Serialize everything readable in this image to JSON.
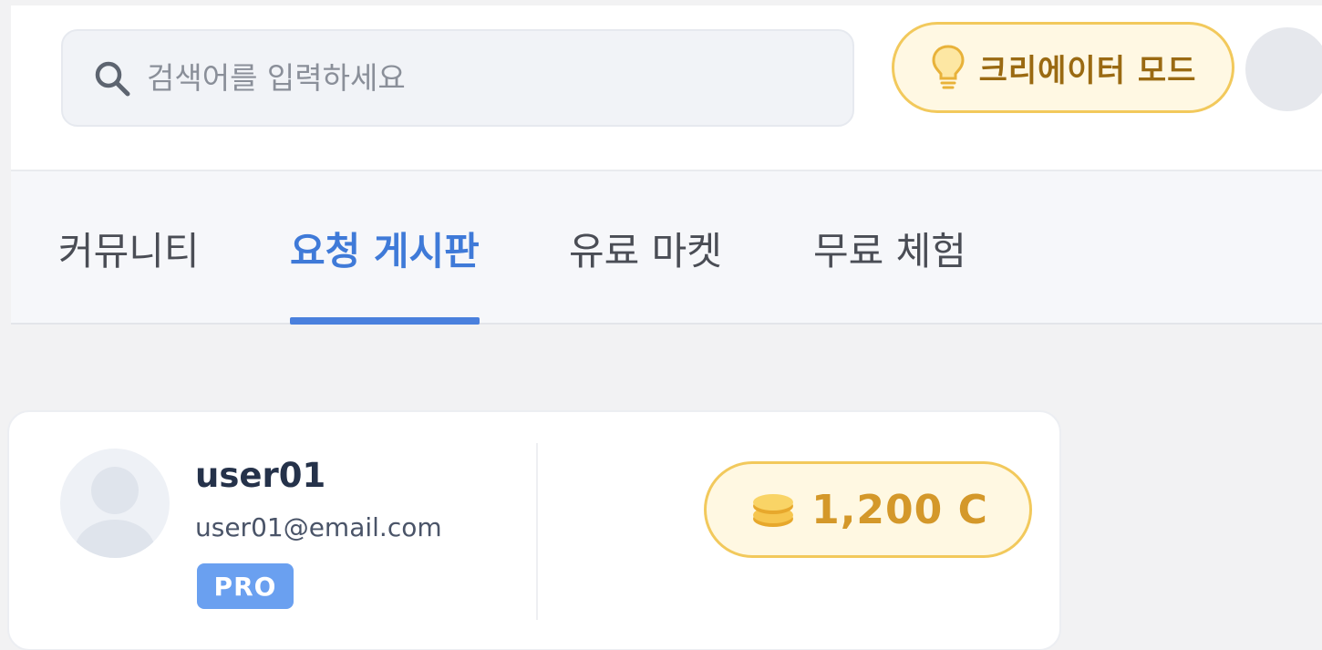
{
  "header": {
    "search": {
      "placeholder": "검색어를 입력하세요",
      "value": ""
    },
    "creator_mode_label": "크리에이터 모드"
  },
  "tabs": [
    {
      "label": "커뮤니티",
      "active": false
    },
    {
      "label": "요청 게시판",
      "active": true
    },
    {
      "label": "유료 마켓",
      "active": false
    },
    {
      "label": "무료 체험",
      "active": false
    }
  ],
  "profile": {
    "username": "user01",
    "email": "user01@email.com",
    "badge": "PRO",
    "credits": "1,200 C"
  },
  "colors": {
    "accent_blue": "#4a80dd",
    "gold": "#d4982a",
    "gold_border": "#f2c95c",
    "badge_blue": "#6aa0f0"
  },
  "icons": [
    "search-icon",
    "lightbulb-icon",
    "avatar",
    "coin-stack-icon"
  ]
}
